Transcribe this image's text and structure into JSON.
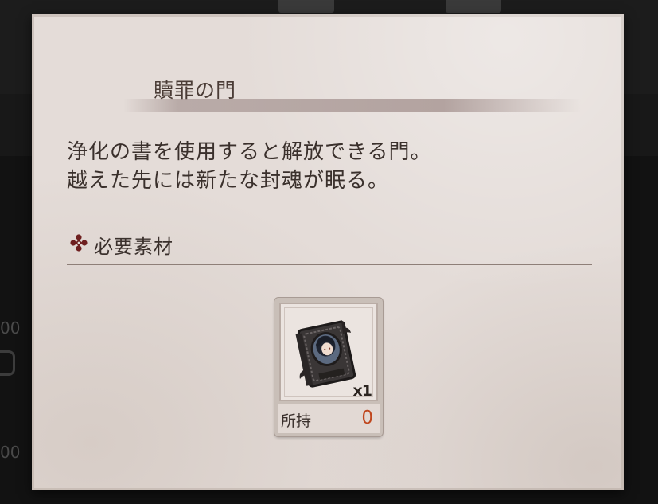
{
  "background": {
    "numbers": [
      "00",
      "00"
    ]
  },
  "dialog": {
    "title": "贖罪の門",
    "description": [
      "浄化の書を使用すると解放できる門。",
      "越えた先には新たな封魂が眠る。"
    ],
    "requirements": {
      "icon": "ornament-cross-icon",
      "label": "必要素材"
    },
    "item": {
      "icon": "purification-book-icon",
      "quantity": "x1",
      "owned_label": "所持",
      "owned_value": "0"
    }
  },
  "colors": {
    "panel": "#e4dcd8",
    "text": "#3a302c",
    "owned_value": "#c0471e",
    "ornament": "#6e1f1f"
  }
}
